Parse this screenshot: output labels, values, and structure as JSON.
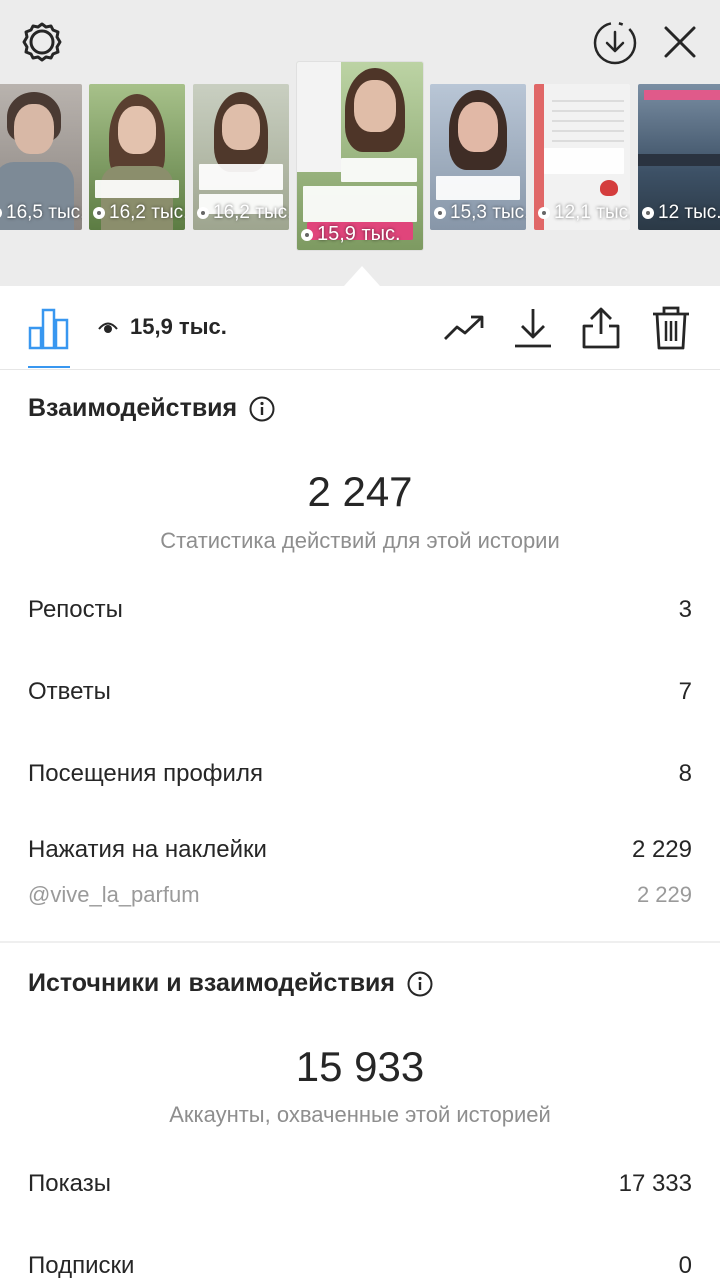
{
  "stories": [
    {
      "views": "16,5 тыс."
    },
    {
      "views": "16,2 тыс."
    },
    {
      "views": "16,2 тыс."
    },
    {
      "views": "15,9 тыс.",
      "selected": true,
      "sticker_text": "@vive_la_parfum"
    },
    {
      "views": "15,3 тыс."
    },
    {
      "views": "12,1 тыс."
    },
    {
      "views": "12 тыс."
    }
  ],
  "toolbar": {
    "views": "15,9 тыс.",
    "accent_color": "#3897f0"
  },
  "interactions": {
    "title": "Взаимодействия",
    "total": "2 247",
    "caption": "Статистика действий для этой истории",
    "rows": [
      {
        "label": "Репосты",
        "value": "3"
      },
      {
        "label": "Ответы",
        "value": "7"
      },
      {
        "label": "Посещения профиля",
        "value": "8"
      },
      {
        "label": "Нажатия на наклейки",
        "value": "2 229"
      }
    ],
    "sticker_sub": {
      "label": "@vive_la_parfum",
      "value": "2 229"
    }
  },
  "discovery": {
    "title": "Источники и взаимодействия",
    "total": "15 933",
    "caption": "Аккаунты, охваченные этой историей",
    "rows": [
      {
        "label": "Показы",
        "value": "17 333"
      },
      {
        "label": "Подписки",
        "value": "0"
      }
    ]
  },
  "icons": [
    "settings-icon",
    "download-circle-icon",
    "close-icon",
    "bar-chart-icon",
    "eye-icon",
    "trend-icon",
    "download-icon",
    "share-icon",
    "trash-icon",
    "info-icon"
  ]
}
